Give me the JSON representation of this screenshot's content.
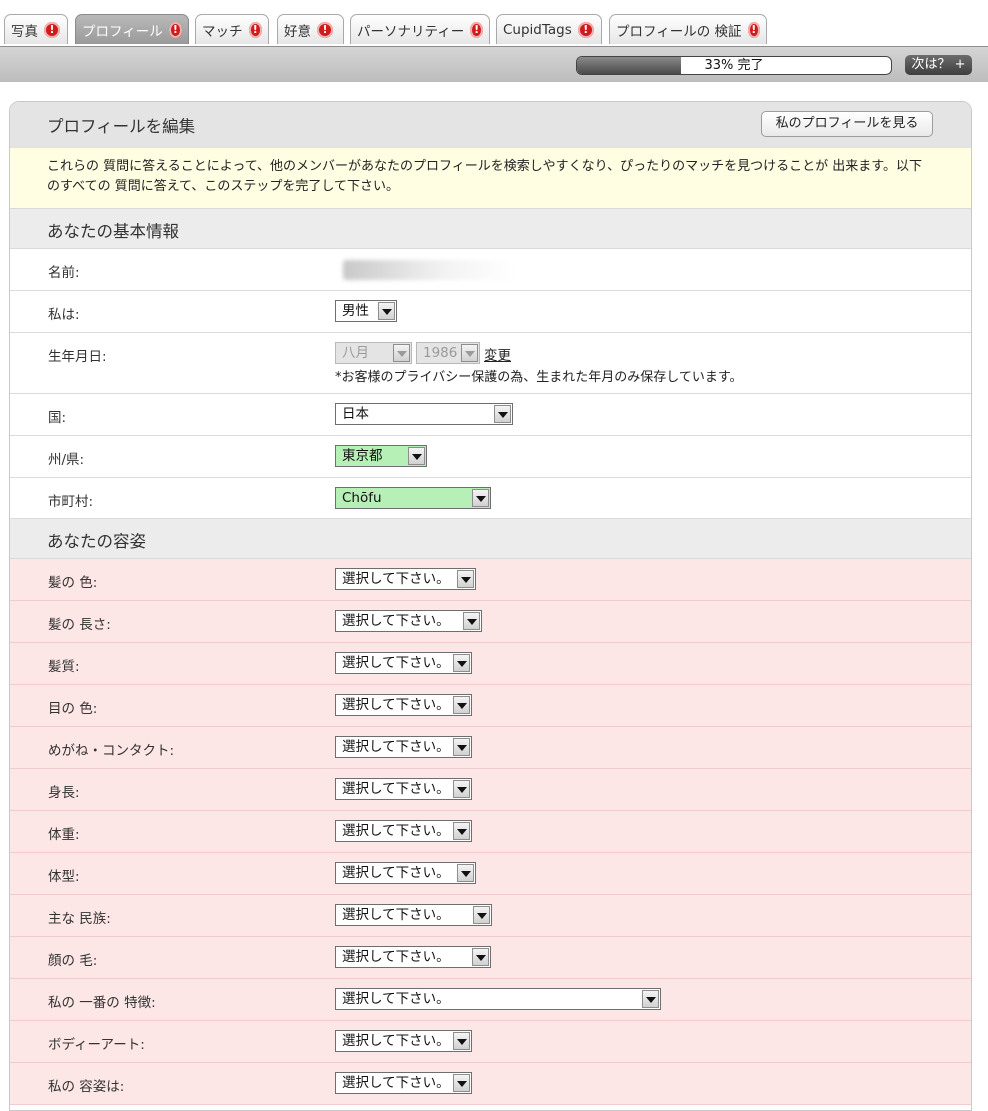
{
  "tabs": [
    {
      "label": "写真",
      "active": false
    },
    {
      "label": "プロフィール",
      "active": true
    },
    {
      "label": "マッチ",
      "active": false
    },
    {
      "label": "好意",
      "active": false
    },
    {
      "label": "パーソナリティー",
      "active": false
    },
    {
      "label": "CupidTags",
      "active": false
    },
    {
      "label": "プロフィールの 検証",
      "active": false
    }
  ],
  "alert_glyph": "!",
  "progress": {
    "percent": 33,
    "label": "33% 完了"
  },
  "next_button": "次は？ +",
  "panel": {
    "title": "プロフィールを編集",
    "view_profile_button": "私のプロフィールを見る",
    "notice": "これらの 質問に答えることによって、他のメンバーがあなたのプロフィールを検索しやすくなり、ぴったりのマッチを見つけることが 出来ます。以下のすべての 質問に答えて、このステップを完了して下さい。"
  },
  "basic_info": {
    "heading": "あなたの基本情報",
    "name_label": "名前:",
    "gender_label": "私は:",
    "gender_value": "男性",
    "birthday_label": "生年月日:",
    "birth_month": "八月",
    "birth_year": "1986",
    "change_link": "変更",
    "birthday_note": "*お客様のプライバシー保護の為、生まれた年月のみ保存しています。",
    "country_label": "国:",
    "country_value": "日本",
    "state_label": "州/県:",
    "state_value": "東京都",
    "city_label": "市町村:",
    "city_value": "Chōfu"
  },
  "appearance": {
    "heading": "あなたの容姿",
    "placeholder": "選択して下さい。",
    "fields": [
      {
        "label": "髪の 色:"
      },
      {
        "label": "髪の 長さ:"
      },
      {
        "label": "髪質:"
      },
      {
        "label": "目の 色:"
      },
      {
        "label": "めがね・コンタクト:"
      },
      {
        "label": "身長:"
      },
      {
        "label": "体重:"
      },
      {
        "label": "体型:"
      },
      {
        "label": "主な 民族:"
      },
      {
        "label": "顔の 毛:"
      },
      {
        "label": "私の 一番の 特徴:"
      },
      {
        "label": "ボディーアート:"
      },
      {
        "label": "私の 容姿は:"
      }
    ]
  },
  "colors": {
    "required_row_bg": "#fde6e6",
    "notice_bg": "#fffde2",
    "filled_select_bg": "#b6f0b6",
    "alert_red": "#d11a1a"
  }
}
